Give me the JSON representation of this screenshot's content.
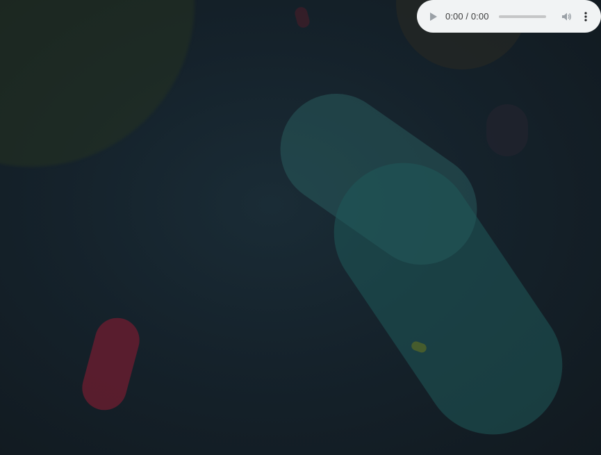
{
  "audio_player": {
    "time_display": "0:00 / 0:00",
    "progress_fraction": 0,
    "icons": [
      "play-icon",
      "volume-icon",
      "more-vertical-icon"
    ]
  },
  "background": {
    "base_color": "#141c22",
    "shape_colors": [
      "#2b3a1e",
      "#2a2a22",
      "#5a1626",
      "#2f6a6c",
      "#3a2838",
      "#4a5a20"
    ]
  }
}
